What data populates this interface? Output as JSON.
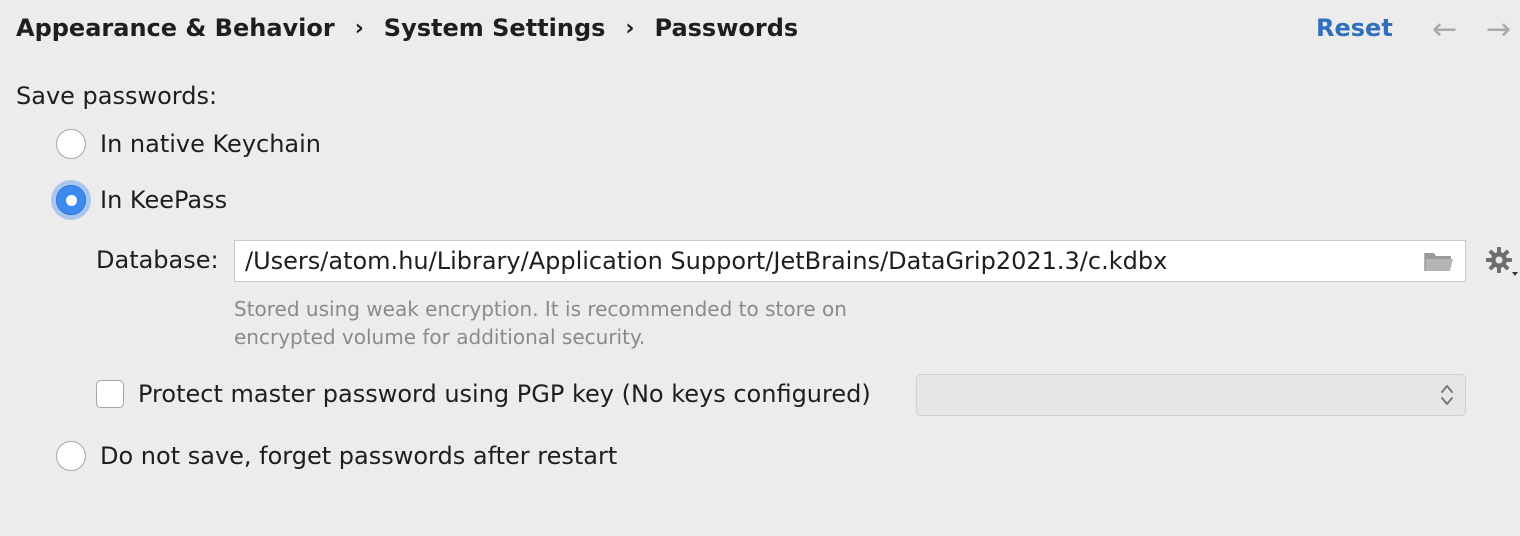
{
  "header": {
    "breadcrumb": [
      "Appearance & Behavior",
      "System Settings",
      "Passwords"
    ],
    "separator": "›",
    "reset_label": "Reset",
    "back_arrow": "←",
    "forward_arrow": "→"
  },
  "save_passwords": {
    "label": "Save passwords:",
    "options": [
      {
        "label": "In native Keychain",
        "selected": false
      },
      {
        "label": "In KeePass",
        "selected": true
      },
      {
        "label": "Do not save, forget passwords after restart",
        "selected": false
      }
    ]
  },
  "keepass": {
    "database_label": "Database:",
    "database_path": "/Users/atom.hu/Library/Application Support/JetBrains/DataGrip2021.3/c.kdbx",
    "hint_line1": "Stored using weak encryption. It is recommended to store on",
    "hint_line2": "encrypted volume for additional security.",
    "pgp_checkbox_label": "Protect master password using PGP key (No keys configured)",
    "pgp_checkbox_checked": false,
    "pgp_select_value": ""
  },
  "icons": {
    "folder": "folder-icon",
    "gear": "gear-icon",
    "select_arrows": "chevron-up-down-icon"
  },
  "colors": {
    "accent": "#3d8bf0",
    "link": "#2f6fbd",
    "background": "#ececec",
    "muted_text": "#8a8a8a"
  }
}
